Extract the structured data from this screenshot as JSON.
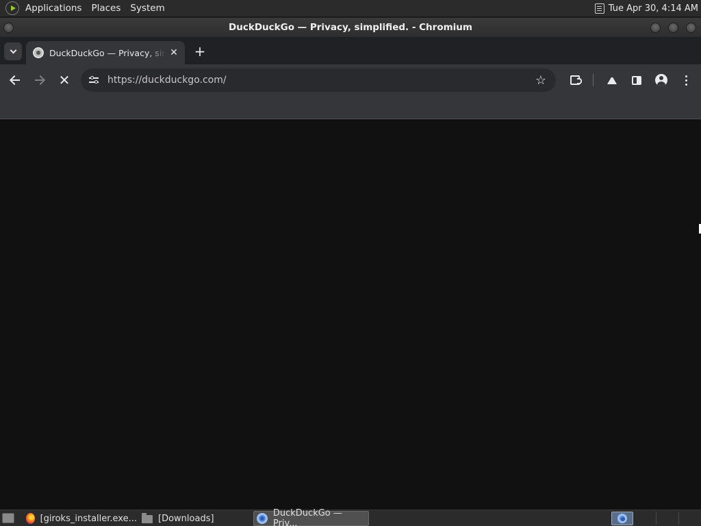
{
  "top_panel": {
    "menus": [
      "Applications",
      "Places",
      "System"
    ],
    "clock": "Tue Apr 30,  4:14 AM"
  },
  "window": {
    "title": "DuckDuckGo — Privacy, simplified. - Chromium"
  },
  "browser": {
    "tab": {
      "title": "DuckDuckGo — Privacy, simplified.",
      "favicon": "duckduckgo-icon"
    },
    "omnibox": {
      "url": "https://duckduckgo.com/"
    },
    "loading": true
  },
  "taskbar": {
    "tasks": [
      {
        "label": "[giroks_installer.exe...",
        "icon": "firefox-icon"
      },
      {
        "label": "[Downloads]",
        "icon": "folder-icon"
      },
      {
        "label": "DuckDuckGo — Priv...",
        "icon": "chromium-icon",
        "active": true
      }
    ]
  },
  "colors": {
    "panel_bg": "#2b2b2b",
    "tab_strip_bg": "#202124",
    "toolbar_bg": "#35363a",
    "content_bg": "#111112"
  }
}
